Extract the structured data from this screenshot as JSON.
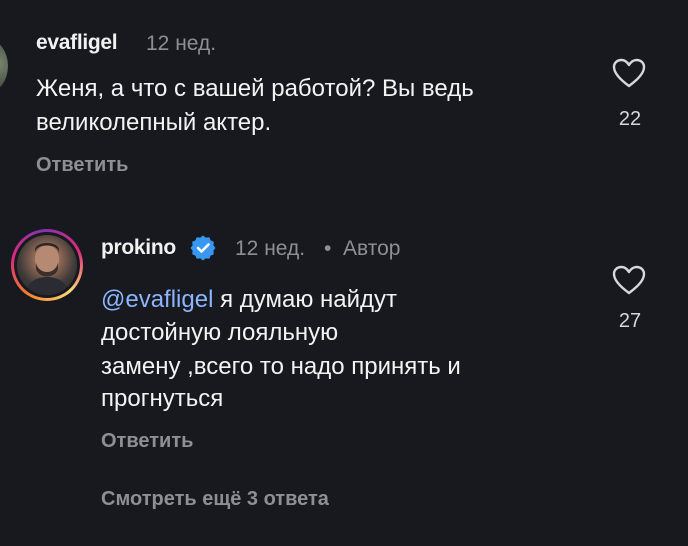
{
  "comment1": {
    "username": "evafligel",
    "time": "12 нед.",
    "text_line1": "Женя, а что с вашей работой? Вы ведь",
    "text_line2": "великолепный актер.",
    "reply_label": "Ответить",
    "likes": "22"
  },
  "comment2": {
    "username": "prokino",
    "time": "12 нед.",
    "separator": "•",
    "author_label": "Автор",
    "mention": "@evafligel",
    "text_line1_rest": " я думаю найдут",
    "text_line2": "достойную лояльную",
    "text_line3": "замену ,всего то надо принять и",
    "text_line4": "прогнуться",
    "reply_label": "Ответить",
    "likes": "27"
  },
  "view_more": "Смотреть ещё 3 ответа",
  "colors": {
    "background": "#17191e",
    "mention": "#8cb4ff",
    "verified": "#3897f0",
    "muted": "#8d8f95"
  }
}
